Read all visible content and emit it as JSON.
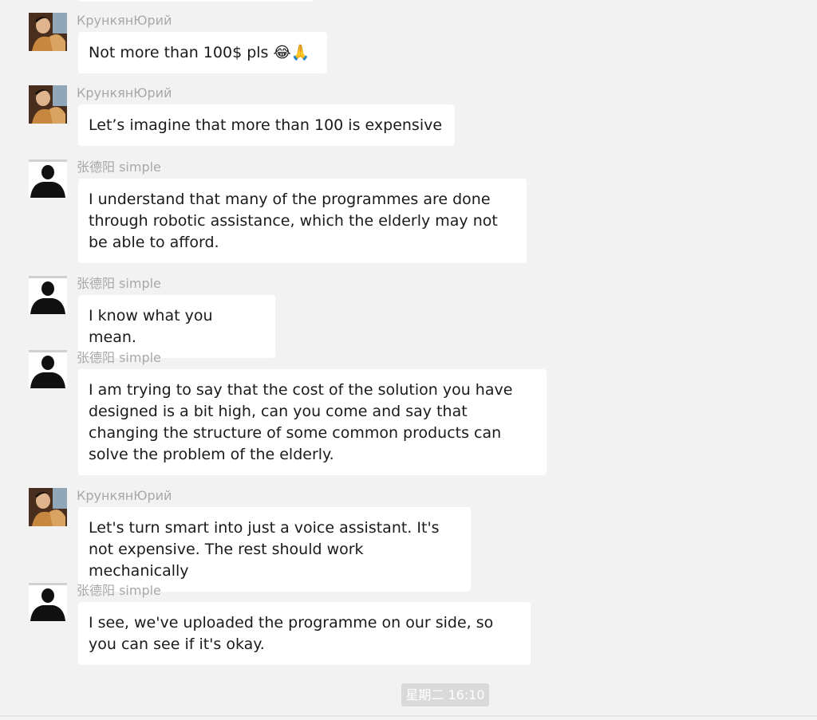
{
  "senders": {
    "yuri": "КрункянЮрий",
    "zhang": "张德阳 simple"
  },
  "messages": [
    {
      "sender": "КрункянЮрий",
      "text": "Not more than 100$ pls 😂🙏"
    },
    {
      "sender": "КрункянЮрий",
      "text": "Let’s imagine that more than 100 is expensive"
    },
    {
      "sender": "张德阳 simple",
      "text": "I understand that many of the programmes are done through robotic assistance, which the elderly may not be able to afford."
    },
    {
      "sender": "张德阳 simple",
      "text": "I know what you mean."
    },
    {
      "sender": "张德阳 simple",
      "text": "I am trying to say that the cost of the solution you have designed is a bit high, can you come and say that changing the structure of some common products can solve the problem of the elderly."
    },
    {
      "sender": "КрункянЮрий",
      "text": "Let's turn smart into just a voice assistant. It's not expensive. The rest should work mechanically"
    },
    {
      "sender": "张德阳 simple",
      "text": "I see, we've uploaded the programme on our side, so you can see if it's okay."
    }
  ],
  "timestamp": "星期二 16:10",
  "icons": {
    "yuri_avatar": "avatar-yuri-photo",
    "zhang_avatar": "avatar-zhang-silhouette"
  }
}
